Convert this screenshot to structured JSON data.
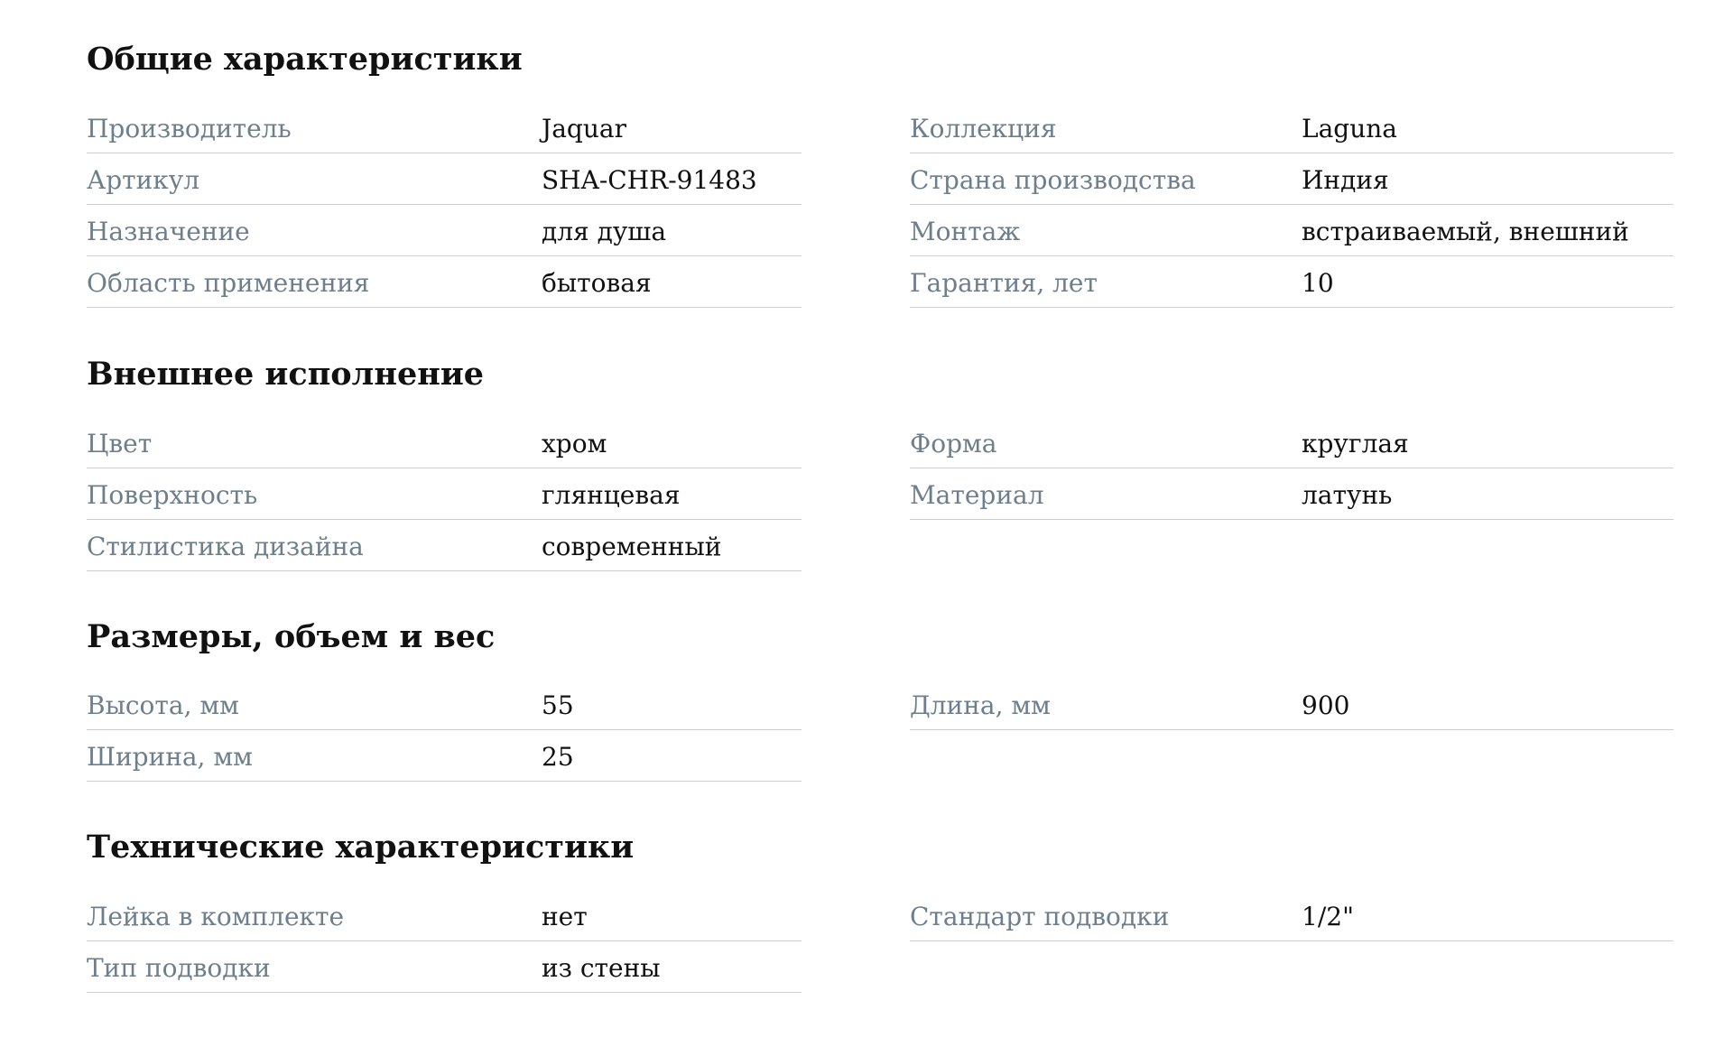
{
  "sections": [
    {
      "title": "Общие характеристики",
      "left": [
        {
          "label": "Производитель",
          "value": "Jaquar"
        },
        {
          "label": "Артикул",
          "value": "SHA-CHR-91483"
        },
        {
          "label": "Назначение",
          "value": "для душа"
        },
        {
          "label": "Область применения",
          "value": "бытовая"
        }
      ],
      "right": [
        {
          "label": "Коллекция",
          "value": "Laguna"
        },
        {
          "label": "Страна производства",
          "value": "Индия"
        },
        {
          "label": "Монтаж",
          "value": "встраиваемый, внешний"
        },
        {
          "label": "Гарантия, лет",
          "value": "10"
        }
      ]
    },
    {
      "title": "Внешнее исполнение",
      "left": [
        {
          "label": "Цвет",
          "value": "хром"
        },
        {
          "label": "Поверхность",
          "value": "глянцевая"
        },
        {
          "label": "Стилистика дизайна",
          "value": "современный"
        }
      ],
      "right": [
        {
          "label": "Форма",
          "value": "круглая"
        },
        {
          "label": "Материал",
          "value": "латунь"
        }
      ]
    },
    {
      "title": "Размеры, объем и вес",
      "left": [
        {
          "label": "Высота, мм",
          "value": "55"
        },
        {
          "label": "Ширина, мм",
          "value": "25"
        }
      ],
      "right": [
        {
          "label": "Длина, мм",
          "value": "900"
        }
      ]
    },
    {
      "title": "Технические характеристики",
      "left": [
        {
          "label": "Лейка в комплекте",
          "value": "нет"
        },
        {
          "label": "Тип подводки",
          "value": "из стены"
        }
      ],
      "right": [
        {
          "label": "Стандарт подводки",
          "value": "1/2\""
        }
      ]
    }
  ],
  "colors": {
    "label": "#6d7f8c",
    "value": "#111111",
    "divider": "#c9ced3",
    "background": "#ffffff"
  }
}
